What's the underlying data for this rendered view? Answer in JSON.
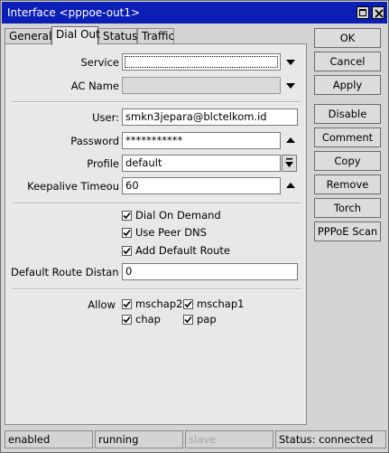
{
  "window": {
    "title": "Interface <pppoe-out1>"
  },
  "tabs": [
    "General",
    "Dial Out",
    "Status",
    "Traffic"
  ],
  "form": {
    "service": {
      "label": "Service",
      "value": ""
    },
    "ac_name": {
      "label": "AC Name",
      "value": ""
    },
    "user": {
      "label": "User:",
      "value": "smkn3jepara@blctelkom.id"
    },
    "password": {
      "label": "Password",
      "value": "***********"
    },
    "profile": {
      "label": "Profile",
      "value": "default"
    },
    "keepalive": {
      "label": "Keepalive Timeou",
      "value": "60"
    },
    "dial_on_demand": {
      "label": "Dial On Demand",
      "checked": true
    },
    "use_peer_dns": {
      "label": "Use Peer DNS",
      "checked": true
    },
    "add_default_route": {
      "label": "Add Default Route",
      "checked": true
    },
    "default_route_distance": {
      "label": "Default Route Distanc",
      "value": "0"
    },
    "allow": {
      "label": "Allow",
      "options": [
        {
          "label": "mschap2",
          "checked": true
        },
        {
          "label": "mschap1",
          "checked": true
        },
        {
          "label": "chap",
          "checked": true
        },
        {
          "label": "pap",
          "checked": true
        }
      ]
    }
  },
  "buttons": [
    "OK",
    "Cancel",
    "Apply",
    "Disable",
    "Comment",
    "Copy",
    "Remove",
    "Torch",
    "PPPoE Scan"
  ],
  "status": {
    "enabled": "enabled",
    "running": "running",
    "slave": "slave",
    "connection": "Status: connected"
  }
}
